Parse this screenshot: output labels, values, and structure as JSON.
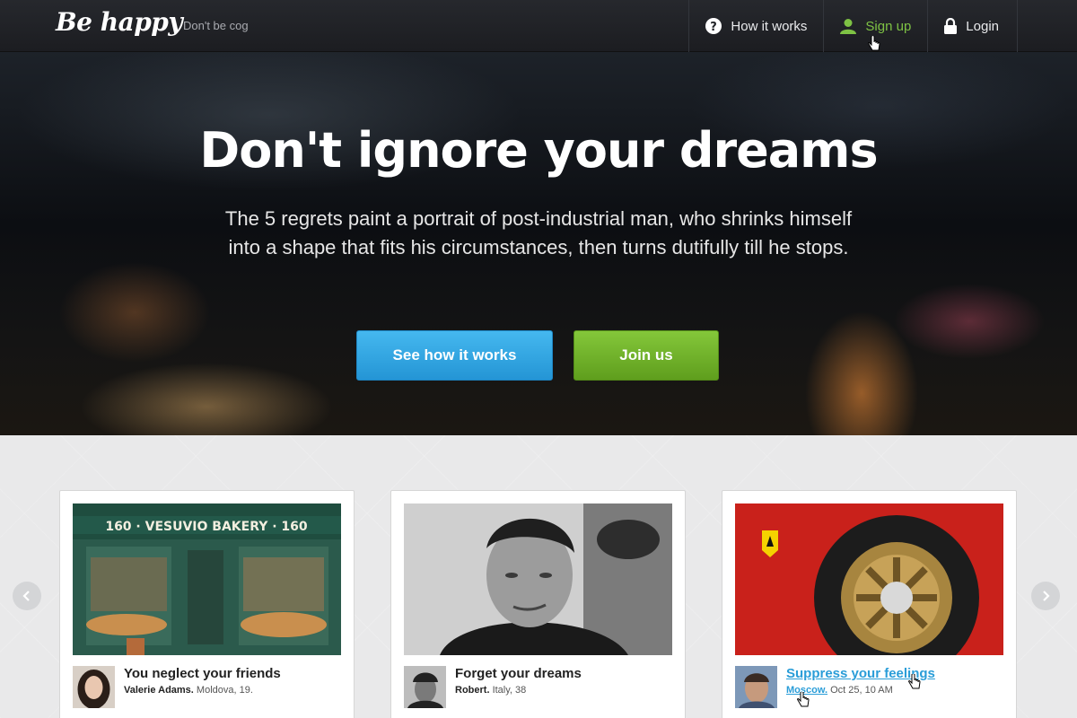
{
  "brand": {
    "logo": "Be happy",
    "tagline": "Don't be cog"
  },
  "nav": {
    "items": [
      {
        "label": "How it works",
        "icon": "question-circle-icon"
      },
      {
        "label": "Sign up",
        "icon": "user-icon"
      },
      {
        "label": "Login",
        "icon": "lock-icon"
      }
    ],
    "active_color": "#7ec244"
  },
  "hero": {
    "title": "Don't ignore your dreams",
    "text": "The 5 regrets paint a portrait of post-industrial man, who shrinks himself into a shape that fits his circumstances, then turns dutifully till he stops.",
    "primary_button": "See how it works",
    "secondary_button": "Join us"
  },
  "cards": [
    {
      "title": "You neglect your friends",
      "author": "Valerie Adams.",
      "details": "Moldova, 19.",
      "image": "bakery-storefront-photo",
      "store_sign": "160 · VESUVIO BAKERY · 160"
    },
    {
      "title": "Forget your dreams",
      "author": "Robert.",
      "details": "Italy, 38",
      "image": "portrait-photo"
    },
    {
      "title": "Suppress your feelings",
      "author": "Moscow.",
      "details": "Oct 25, 10 AM",
      "image": "ferrari-wheel-photo"
    }
  ],
  "colors": {
    "blue_button": "#2a9dd8",
    "green_button": "#6fb12a",
    "link": "#2a9dd8"
  }
}
